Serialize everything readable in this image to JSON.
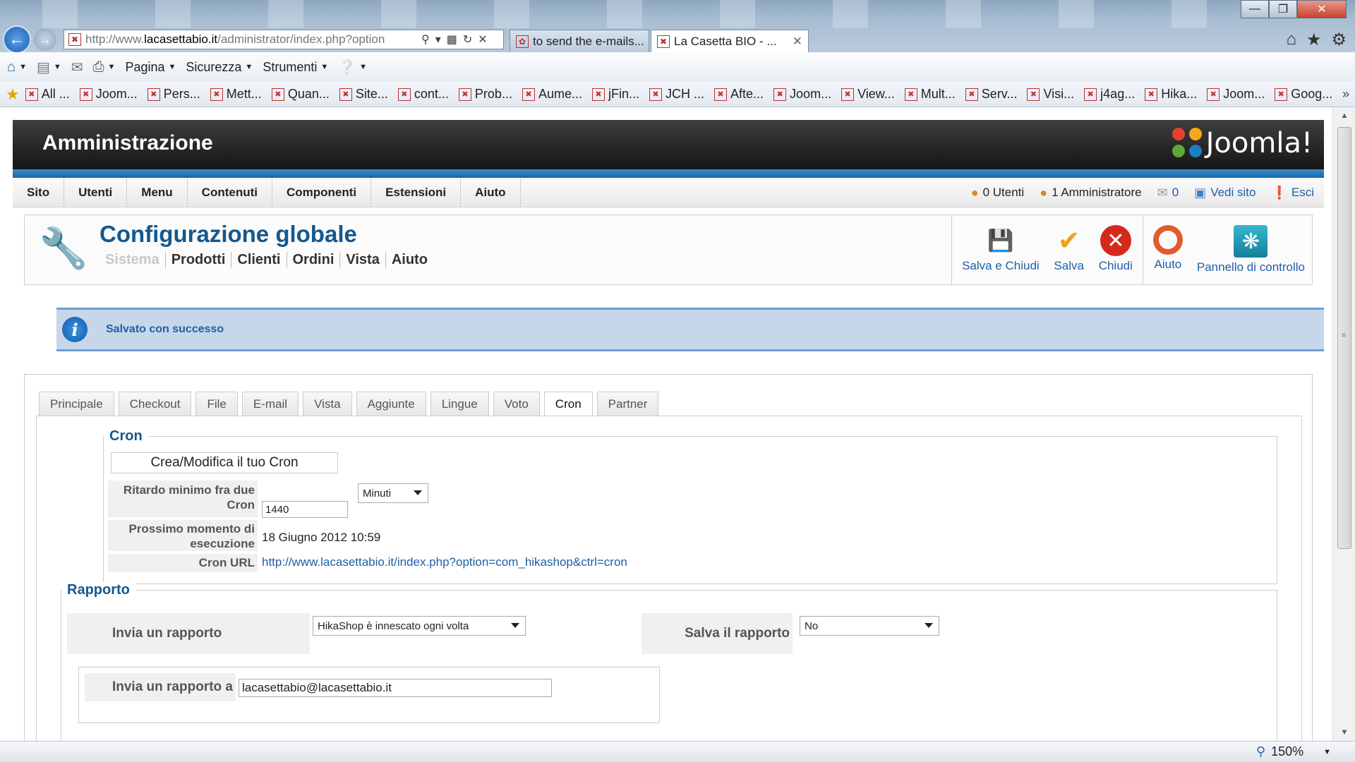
{
  "browser": {
    "url_prefix": "http://www.",
    "url_domain": "lacasettabio.it",
    "url_rest": "/administrator/index.php?option",
    "tabs": [
      {
        "title": "to send the e-mails..."
      },
      {
        "title": "La Casetta BIO - ..."
      }
    ],
    "commands": {
      "pagina": "Pagina",
      "sicurezza": "Sicurezza",
      "strumenti": "Strumenti"
    },
    "favorites": [
      "All ...",
      "Joom...",
      "Pers...",
      "Mett...",
      "Quan...",
      "Site...",
      "cont...",
      "Prob...",
      "Aume...",
      "jFin...",
      "JCH ...",
      "Afte...",
      "Joom...",
      "View...",
      "Mult...",
      "Serv...",
      "Visi...",
      "j4ag...",
      "Hika...",
      "Joom...",
      "Goog..."
    ],
    "zoom": "150%"
  },
  "admin": {
    "header_title": "Amministrazione",
    "logo_text": "Joomla!",
    "menu": [
      "Sito",
      "Utenti",
      "Menu",
      "Contenuti",
      "Componenti",
      "Estensioni",
      "Aiuto"
    ],
    "status": {
      "users": "0 Utenti",
      "admins": "1 Amministratore",
      "messages": "0",
      "view_site": "Vedi sito",
      "logout": "Esci"
    }
  },
  "page": {
    "title": "Configurazione globale",
    "subnav": [
      "Sistema",
      "Prodotti",
      "Clienti",
      "Ordini",
      "Vista",
      "Aiuto"
    ],
    "toolbar": {
      "save_close": "Salva e Chiudi",
      "save": "Salva",
      "close": "Chiudi",
      "help": "Aiuto",
      "control_panel": "Pannello di controllo"
    },
    "message": "Salvato con successo",
    "tabs": [
      "Principale",
      "Checkout",
      "File",
      "E-mail",
      "Vista",
      "Aggiunte",
      "Lingue",
      "Voto",
      "Cron",
      "Partner"
    ],
    "active_tab": "Cron"
  },
  "cron": {
    "legend": "Cron",
    "edit_button": "Crea/Modifica il tuo Cron",
    "min_delay_label": "Ritardo minimo fra due Cron",
    "min_delay_value": "1440",
    "min_delay_unit": "Minuti",
    "next_run_label": "Prossimo momento di esecuzione",
    "next_run_value": "18 Giugno 2012 10:59",
    "url_label": "Cron URL",
    "url_value": "http://www.lacasettabio.it/index.php?option=com_hikashop&ctrl=cron"
  },
  "report": {
    "legend": "Rapporto",
    "send_label": "Invia un rapporto",
    "send_value": "HikaShop è innescato ogni volta",
    "save_label": "Salva il rapporto",
    "save_value": "No",
    "send_to_label": "Invia un rapporto a",
    "send_to_value": "lacasettabio@lacasettabio.it"
  }
}
